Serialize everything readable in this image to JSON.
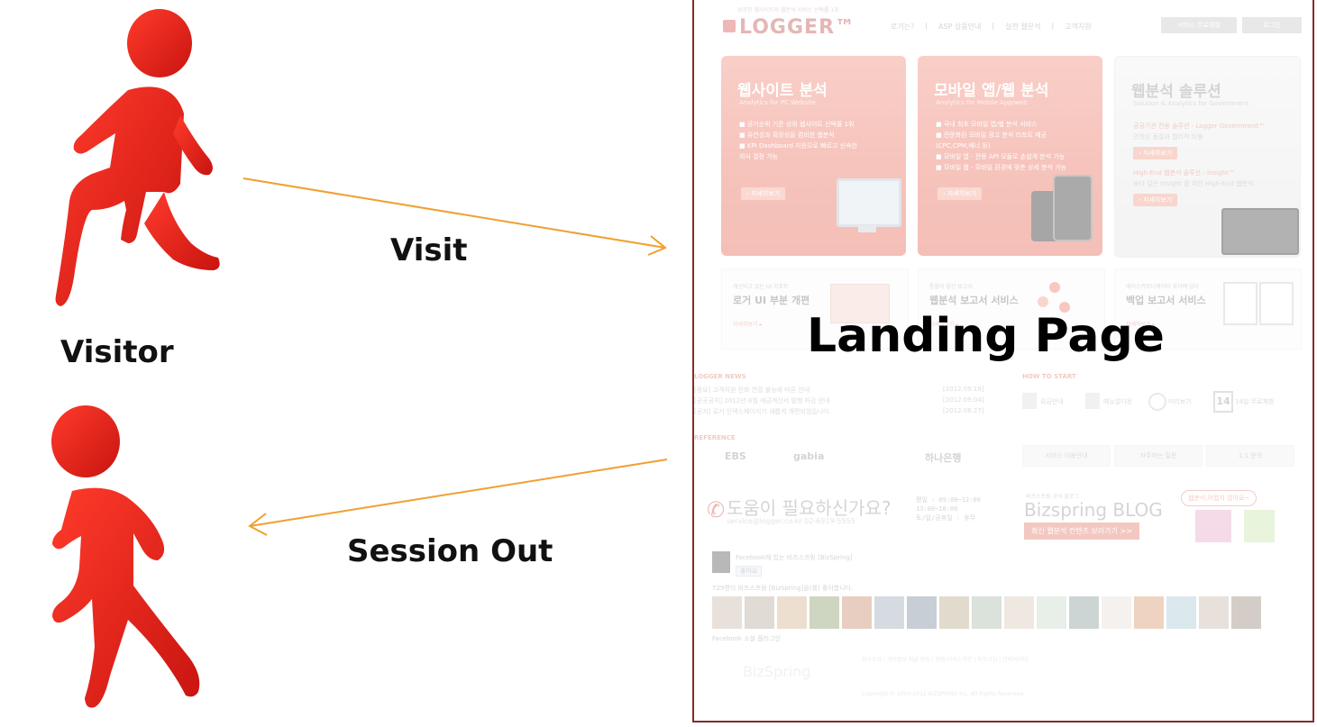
{
  "labels": {
    "visit": "Visit",
    "visitor": "Visitor",
    "session_out": "Session Out",
    "landing_page": "Landing Page"
  },
  "colors": {
    "figure_red": "#e8241a",
    "arrow_orange": "#f0a030",
    "frame_border": "#8a2a2a"
  },
  "icons": {
    "visitor_entering": "running-person-icon",
    "visitor_leaving": "walking-person-icon"
  },
  "landing": {
    "tagline": "성공한 웹사이트의 웹분석 서비스 선택률 1위",
    "logo": "LOGGER™",
    "nav": [
      "로거는?",
      "|",
      "ASP 상품안내",
      "|",
      "실전 웹분석",
      "|",
      "고객지원"
    ],
    "btn_trial": "서비스 무료체험",
    "btn_login": "로그인",
    "cards": [
      {
        "title": "웹사이트 분석",
        "subtitle": "Analytics for PC Website",
        "items": [
          "■ 공기순위 기준 상위 웹사이트 선택률 1위",
          "■ 유연성과 확장성을 겸비한 웹분석",
          "■ KPI Dashboard 지원으로 빠르고 신속한",
          "   의사 결정 가능"
        ],
        "more": "› 자세히보기"
      },
      {
        "title": "모바일 앱/웹 분석",
        "subtitle": "Analytics for Mobile App/web",
        "items": [
          "■ 국내 최초 모바일 앱/웹 분석 서비스",
          "■ 전문화된 모바일 광고 분석 리포트 제공",
          "   (CPC,CPM,배너 등)",
          "■ 모바일 앱 - 전용 API 모듈로 손쉽게 분석 가능",
          "■ 모바일 웹 - 모바일 환경에 맞춘 상세 분석 가능"
        ],
        "more": "› 자세히보기"
      },
      {
        "title": "웹분석 솔루션",
        "subtitle": "Solution & Analytics for Government",
        "line1": "공공기관 전용 솔루션 - Logger Government™",
        "text1": "안정된 품질과 합리적 비용",
        "more1": "› 자세히보기",
        "line2": "High-End 웹분석 솔루션 - Insight™",
        "text2": "보다 깊은 Insight 를 위한 High-End 웹분석",
        "more2": "› 자세히보기"
      }
    ],
    "services": [
      {
        "small": "개선되고 있는 UI 리포트",
        "title": "로거 UI 부분 개편",
        "link": "자세히보기 ▸"
      },
      {
        "small": "통찰이 담긴 보고서",
        "title": "웹분석 보고서 서비스",
        "link": "자세히보기 ▸"
      },
      {
        "small": "레이스커뮤니케이터 로거에 담다",
        "title": "백업 보고서 서비스",
        "link": "자세히보기 ▸"
      }
    ],
    "news": {
      "heading": "LOGGER NEWS",
      "rows": [
        {
          "text": "[중요] 고객지원 전화 연결 불능에 따른 안내",
          "date": "[2012.09.19]"
        },
        {
          "text": "[공공공지] 2012년 8월 세금계산서 발행 마감 안내",
          "date": "[2012.09.04]"
        },
        {
          "text": "[공지] 로거 인덱스페이지가 새롭게 개편되었습니다.",
          "date": "[2012.08.27]"
        }
      ]
    },
    "howto": {
      "heading": "HOW TO START",
      "items": [
        "요금안내",
        "매뉴얼다운",
        "미리보기",
        "14일 무료체험"
      ],
      "calendar_day": "14"
    },
    "reference": {
      "heading": "REFERENCE",
      "logos": [
        "EBS",
        "gabia",
        "하나은행"
      ],
      "buttons": [
        "서비스 이용안내",
        "자주하는 질문",
        "1:1 문의"
      ]
    },
    "help": {
      "title": "도움이 필요하신가요?",
      "contact": "service@logger.co.kr  02-6919-5555",
      "hours": [
        "평일 : 09:00~12:00",
        "      13:00~18:00",
        "토/일/공휴일 : 휴무"
      ]
    },
    "blog": {
      "small": "비즈스프링 공식 블로그",
      "title": "Bizspring BLOG",
      "button": "최신 웹분석 컨텐츠 보러가기 >>",
      "bubble": "웹분석,어렵지 않아요~"
    },
    "facebook": {
      "line": "Facebook에 있는 비즈스프링 [BizSpring]",
      "like": "좋아요",
      "count_line": "729명이 비즈스프링 [BizSpring]을(를) 좋아합니다.",
      "plugin": "Facebook 소셜 플러그인"
    },
    "footer": {
      "brand": "BizSpring",
      "links": "회사소개  |  개인정보 취급 방침  |  회원/서비스약관  |  파트너십  |  연락처/약도",
      "copyright": "Copyright © 2000-2012 BIZSPRING Inc. All Rights Reserved."
    }
  }
}
